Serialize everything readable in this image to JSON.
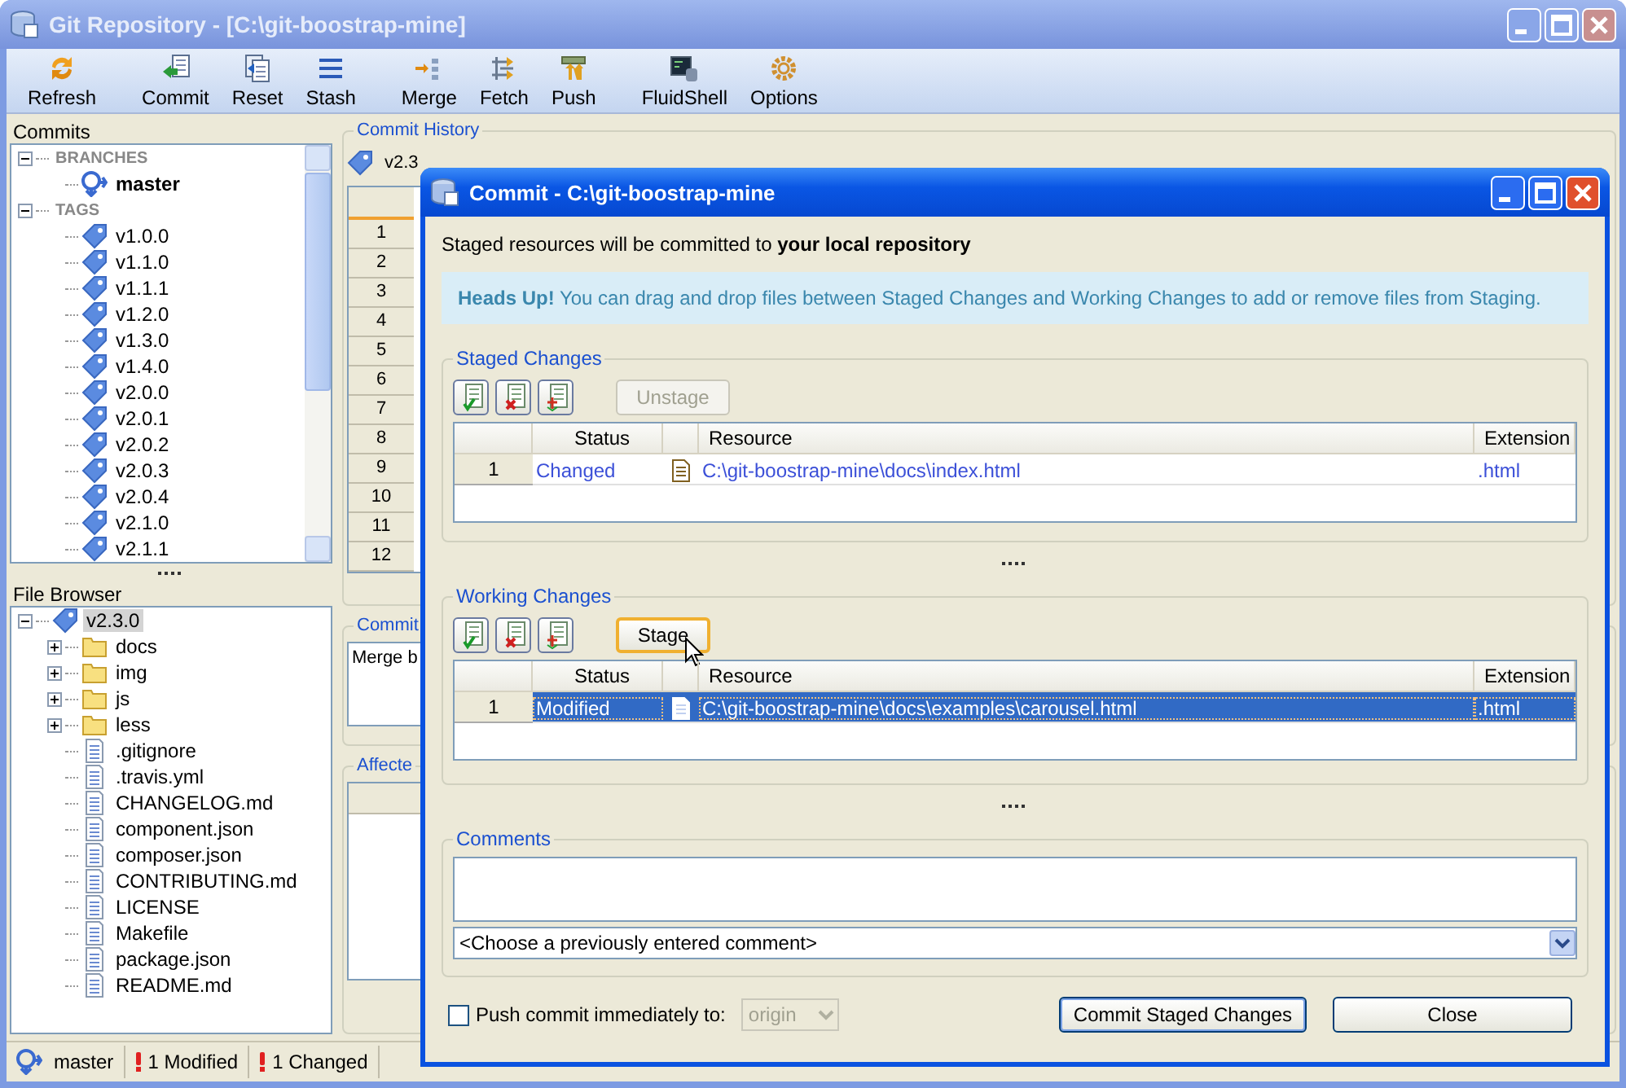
{
  "window": {
    "title": "Git Repository - [C:\\git-boostrap-mine]"
  },
  "toolbar": [
    [
      {
        "label": "Refresh"
      }
    ],
    [
      {
        "label": "Commit"
      },
      {
        "label": "Reset"
      },
      {
        "label": "Stash"
      }
    ],
    [
      {
        "label": "Merge"
      },
      {
        "label": "Fetch"
      },
      {
        "label": "Push"
      }
    ],
    [
      {
        "label": "FluidShell"
      },
      {
        "label": "Options"
      }
    ]
  ],
  "commits": {
    "title": "Commits",
    "tree": [
      {
        "label": "BRANCHES",
        "kind": "group",
        "expanded": true,
        "children": [
          {
            "label": "master",
            "kind": "branch"
          }
        ]
      },
      {
        "label": "TAGS",
        "kind": "group",
        "expanded": true,
        "children": [
          {
            "label": "v1.0.0",
            "kind": "tag"
          },
          {
            "label": "v1.1.0",
            "kind": "tag"
          },
          {
            "label": "v1.1.1",
            "kind": "tag"
          },
          {
            "label": "v1.2.0",
            "kind": "tag"
          },
          {
            "label": "v1.3.0",
            "kind": "tag"
          },
          {
            "label": "v1.4.0",
            "kind": "tag"
          },
          {
            "label": "v2.0.0",
            "kind": "tag"
          },
          {
            "label": "v2.0.1",
            "kind": "tag"
          },
          {
            "label": "v2.0.2",
            "kind": "tag"
          },
          {
            "label": "v2.0.3",
            "kind": "tag"
          },
          {
            "label": "v2.0.4",
            "kind": "tag"
          },
          {
            "label": "v2.1.0",
            "kind": "tag"
          },
          {
            "label": "v2.1.1",
            "kind": "tag"
          }
        ]
      }
    ]
  },
  "file_browser": {
    "title": "File Browser",
    "tree": [
      {
        "label": "v2.3.0",
        "kind": "tag",
        "selected": true,
        "expanded": true,
        "children": [
          {
            "label": "docs",
            "kind": "folder",
            "expanded": false
          },
          {
            "label": "img",
            "kind": "folder",
            "expanded": false
          },
          {
            "label": "js",
            "kind": "folder",
            "expanded": false
          },
          {
            "label": "less",
            "kind": "folder",
            "expanded": false
          },
          {
            "label": ".gitignore",
            "kind": "file"
          },
          {
            "label": ".travis.yml",
            "kind": "file"
          },
          {
            "label": "CHANGELOG.md",
            "kind": "file"
          },
          {
            "label": "component.json",
            "kind": "file"
          },
          {
            "label": "composer.json",
            "kind": "file"
          },
          {
            "label": "CONTRIBUTING.md",
            "kind": "file"
          },
          {
            "label": "LICENSE",
            "kind": "file"
          },
          {
            "label": "Makefile",
            "kind": "file"
          },
          {
            "label": "package.json",
            "kind": "file"
          },
          {
            "label": "README.md",
            "kind": "file"
          }
        ]
      }
    ]
  },
  "commit_history": {
    "title": "Commit History",
    "tag": "v2.3",
    "row_numbers": [
      "1",
      "2",
      "3",
      "4",
      "5",
      "6",
      "7",
      "8",
      "9",
      "10",
      "11",
      "12"
    ]
  },
  "commit_details": {
    "title": "Commit",
    "message": "Merge b"
  },
  "affected": {
    "title": "Affecte"
  },
  "status_bar": [
    {
      "kind": "branch",
      "text": "master"
    },
    {
      "kind": "alert",
      "text": "1 Modified"
    },
    {
      "kind": "alert",
      "text": "1 Changed"
    }
  ],
  "dialog": {
    "title": "Commit - C:\\git-boostrap-mine",
    "intro": "Staged resources will be committed to **your local repository**",
    "notice": "**Heads Up!** You can drag and drop files between Staged Changes and Working Changes to add or remove files from Staging.",
    "sections": [
      {
        "title": "Staged Changes",
        "action": {
          "label": "Unstage",
          "disabled": true,
          "hot": false
        },
        "columns": [
          "Status",
          "Resource",
          "Extension"
        ],
        "rows": [
          {
            "number": "1",
            "status": "Changed",
            "resource": "C:\\git-boostrap-mine\\docs\\index.html",
            "extension": ".html",
            "selected": false
          }
        ]
      },
      {
        "title": "Working Changes",
        "action": {
          "label": "Stage",
          "disabled": false,
          "hot": true
        },
        "columns": [
          "Status",
          "Resource",
          "Extension"
        ],
        "rows": [
          {
            "number": "1",
            "status": "Modified",
            "resource": "C:\\git-boostrap-mine\\docs\\examples\\carousel.html",
            "extension": ".html",
            "selected": true
          }
        ]
      }
    ],
    "comments": {
      "title": "Comments",
      "history_value": "<Choose a previously entered comment>"
    },
    "push": {
      "label": "Push commit immediately to:",
      "checked": false,
      "remote": "origin",
      "remote_disabled": true
    },
    "buttons": [
      {
        "label": "Commit Staged Changes",
        "default": true
      },
      {
        "label": "Close",
        "default": false
      }
    ]
  }
}
